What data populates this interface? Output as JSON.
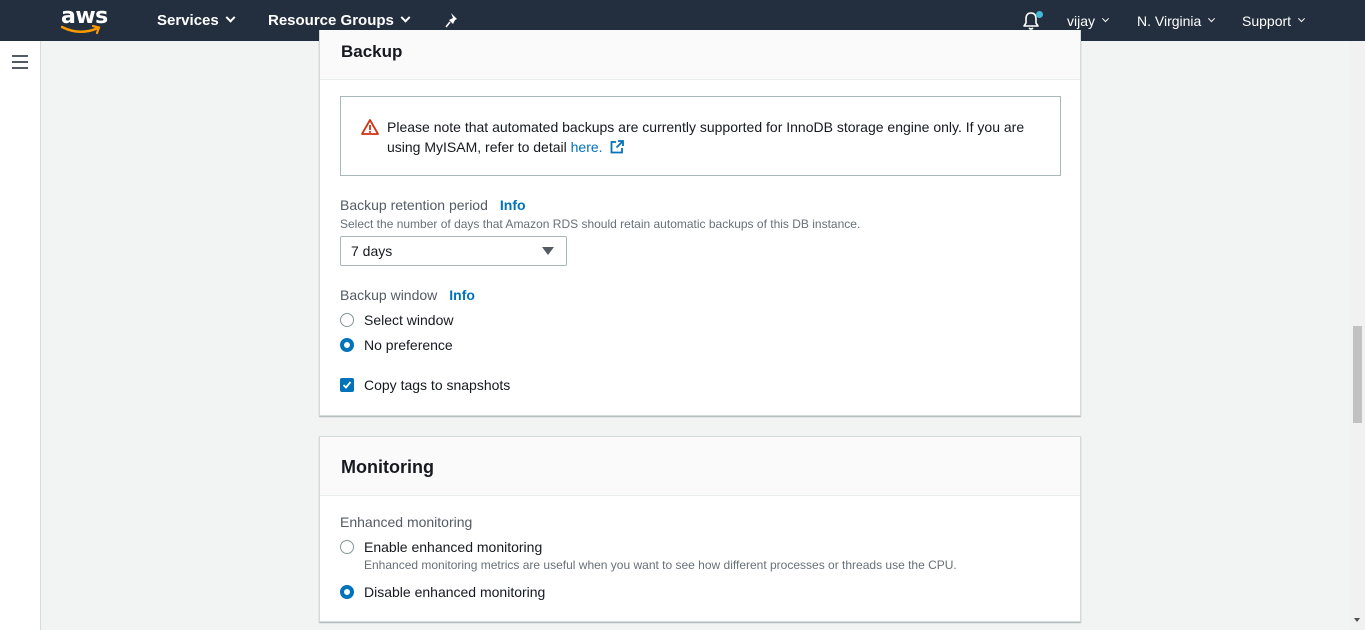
{
  "nav": {
    "logo_text": "aws",
    "services": "Services",
    "resource_groups": "Resource Groups",
    "user": "vijay",
    "region": "N. Virginia",
    "support": "Support"
  },
  "backup": {
    "title": "Backup",
    "alert_text": "Please note that automated backups are currently supported for InnoDB storage engine only. If you are using MyISAM, refer to detail ",
    "alert_link": "here.",
    "retention_label": "Backup retention period",
    "retention_info": "Info",
    "retention_desc": "Select the number of days that Amazon RDS should retain automatic backups of this DB instance.",
    "retention_value": "7 days",
    "window_label": "Backup window",
    "window_info": "Info",
    "window_options": [
      "Select window",
      "No preference"
    ],
    "window_selected": "No preference",
    "copy_tags_label": "Copy tags to snapshots",
    "copy_tags_checked": true
  },
  "monitoring": {
    "title": "Monitoring",
    "enhanced_label": "Enhanced monitoring",
    "enable_label": "Enable enhanced monitoring",
    "enable_desc": "Enhanced monitoring metrics are useful when you want to see how different processes or threads use the CPU.",
    "disable_label": "Disable enhanced monitoring",
    "selected": "Disable enhanced monitoring"
  },
  "colors": {
    "nav_bg": "#232f3e",
    "link": "#0073bb",
    "warning": "#d13212",
    "smile": "#ff9900"
  }
}
